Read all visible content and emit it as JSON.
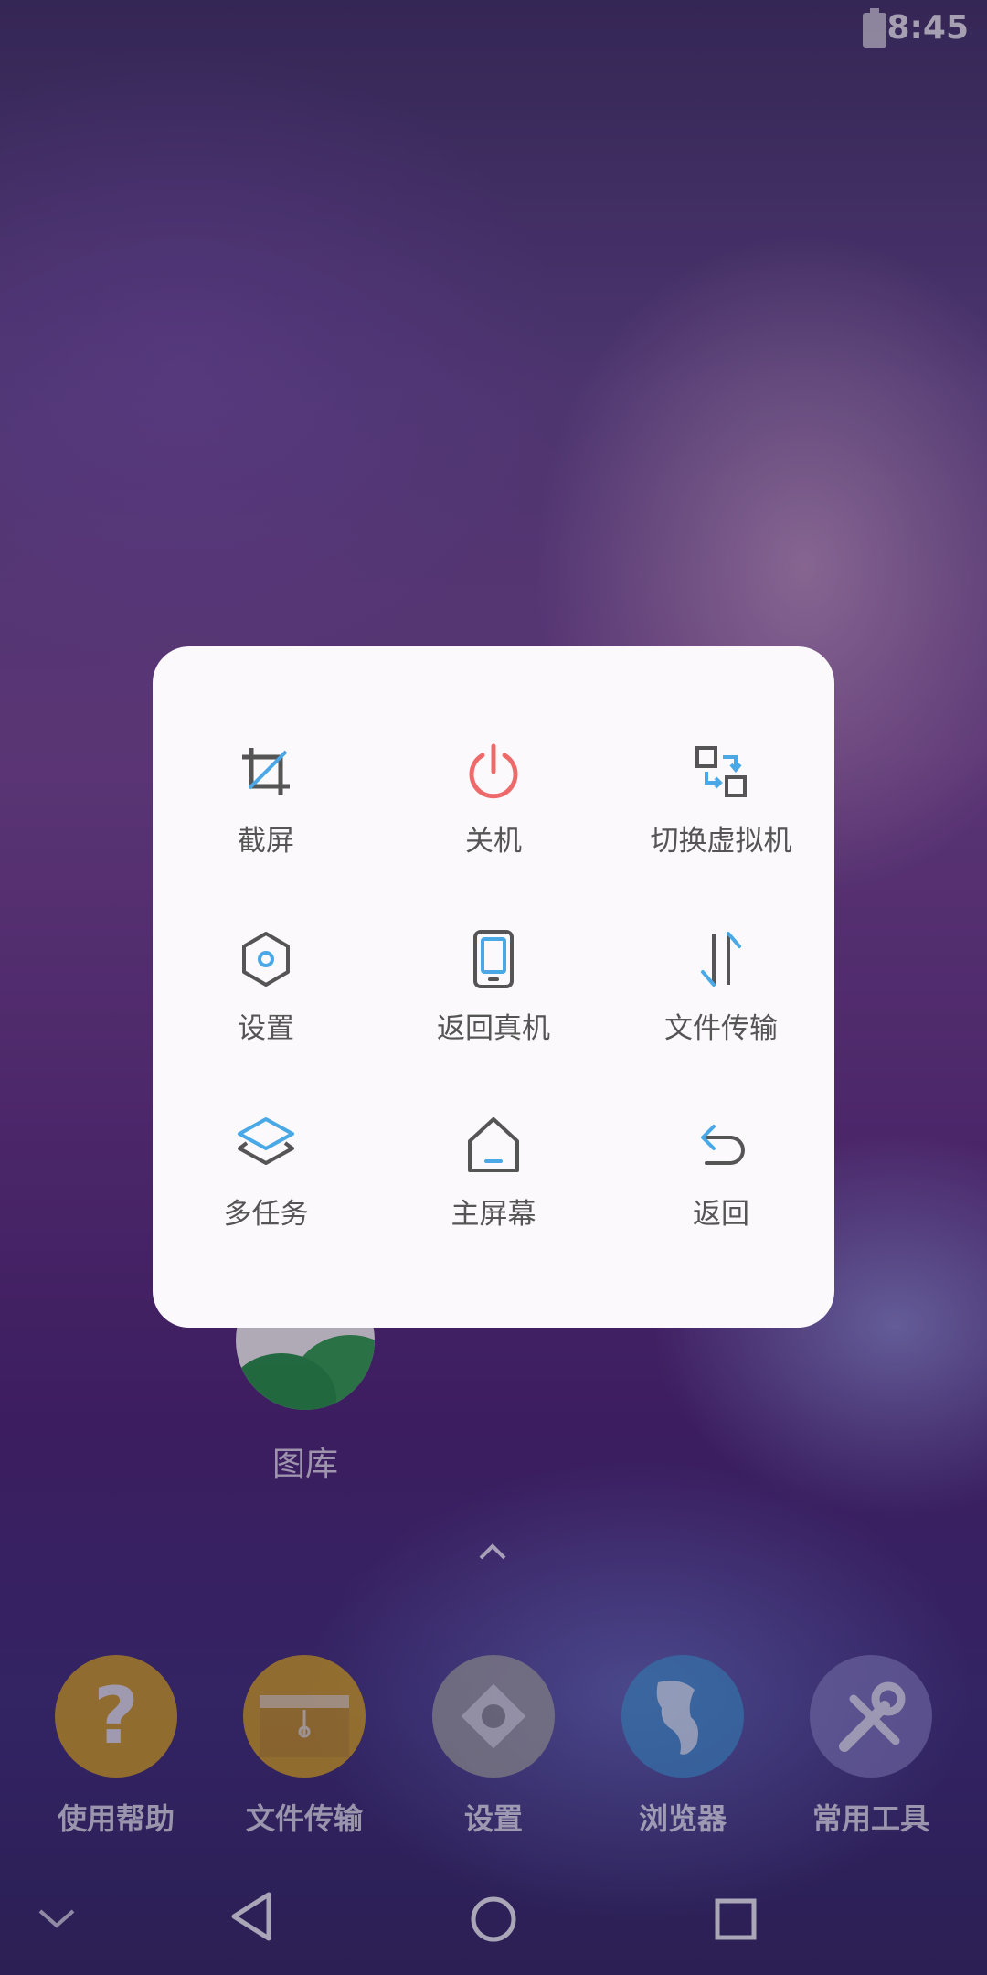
{
  "status_bar": {
    "time": "8:45"
  },
  "home": {
    "gallery_label": "图库",
    "dock": [
      {
        "label": "使用帮助",
        "color": "#d9a51a"
      },
      {
        "label": "文件传输",
        "color": "#d9a51a"
      },
      {
        "label": "设置",
        "color": "#9a9a9a"
      },
      {
        "label": "浏览器",
        "color": "#3c88c4"
      },
      {
        "label": "常用工具",
        "color": "#7a73b6"
      }
    ]
  },
  "menu": {
    "items": [
      {
        "label": "截屏",
        "icon": "crop-icon"
      },
      {
        "label": "关机",
        "icon": "power-icon"
      },
      {
        "label": "切换虚拟机",
        "icon": "switch-vm-icon"
      },
      {
        "label": "设置",
        "icon": "hexagon-settings-icon"
      },
      {
        "label": "返回真机",
        "icon": "phone-icon"
      },
      {
        "label": "文件传输",
        "icon": "transfer-arrows-icon"
      },
      {
        "label": "多任务",
        "icon": "layers-icon"
      },
      {
        "label": "主屏幕",
        "icon": "home-icon"
      },
      {
        "label": "返回",
        "icon": "back-arrow-icon"
      }
    ]
  },
  "colors": {
    "accent": "#4aa8e6",
    "power": "#ee6a6a",
    "icon_gray": "#555555"
  }
}
